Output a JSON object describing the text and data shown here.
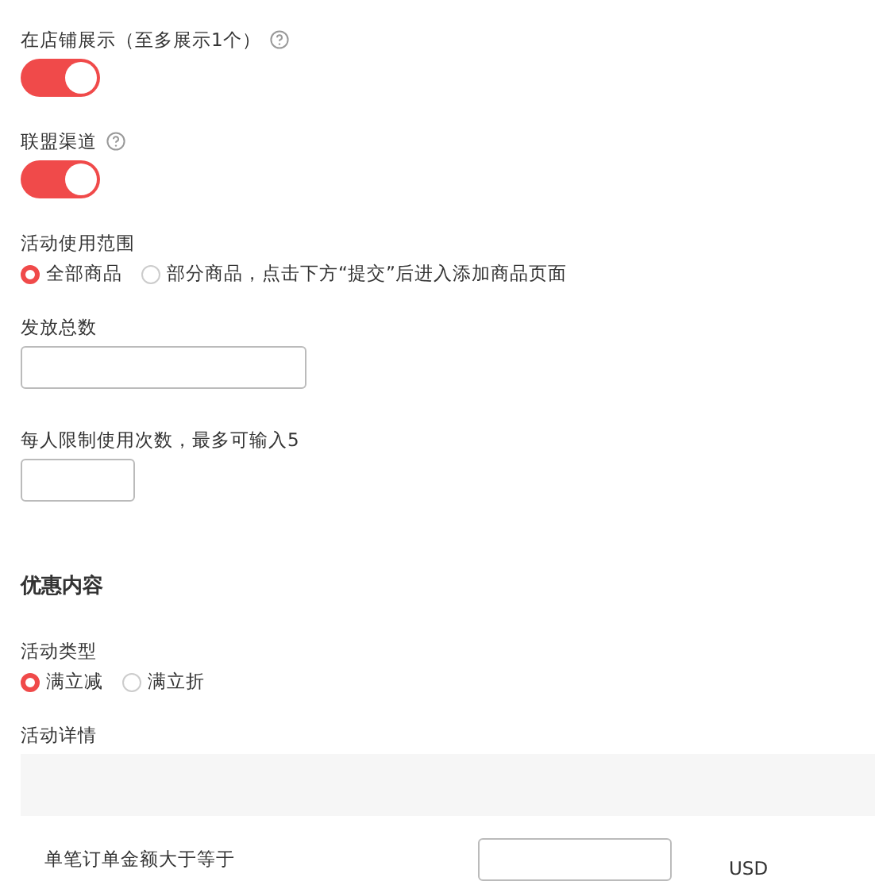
{
  "toggles": [
    {
      "label": "在店铺展示（至多展示1个）",
      "help": true,
      "on": true
    },
    {
      "label": "联盟渠道",
      "help": true,
      "on": true
    }
  ],
  "scope": {
    "label": "活动使用范围",
    "options": [
      {
        "label": "全部商品",
        "selected": true
      },
      {
        "label": "部分商品，点击下方“提交”后进入添加商品页面",
        "selected": false
      }
    ]
  },
  "total": {
    "label": "发放总数"
  },
  "per_user": {
    "label": "每人限制使用次数，最多可输入5"
  },
  "section_title": "优惠内容",
  "type": {
    "label": "活动类型",
    "options": [
      {
        "label": "满立减",
        "selected": true
      },
      {
        "label": "满立折",
        "selected": false
      }
    ]
  },
  "details": {
    "label": "活动详情",
    "rows": [
      {
        "label": "单笔订单金额大于等于",
        "unit": "USD"
      }
    ]
  }
}
